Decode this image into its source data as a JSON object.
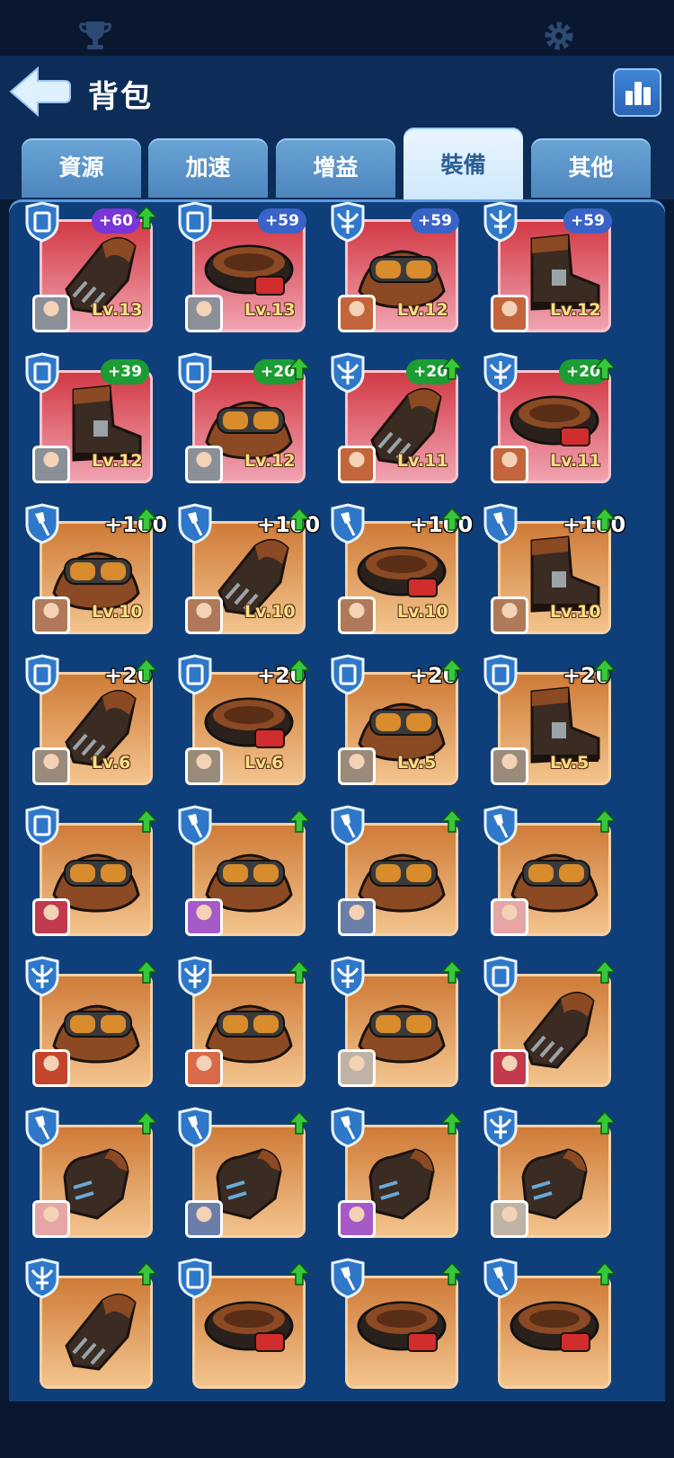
{
  "topbar": {
    "left_icon": "trophy-icon",
    "right_icon": "gear-icon"
  },
  "header": {
    "title": "背包",
    "back_icon": "back-arrow-icon",
    "stats_icon": "bar-chart-icon"
  },
  "tabs": [
    {
      "label": "資源",
      "active": false
    },
    {
      "label": "加速",
      "active": false
    },
    {
      "label": "增益",
      "active": false
    },
    {
      "label": "裝備",
      "active": true
    },
    {
      "label": "其他",
      "active": false
    }
  ],
  "items": [
    {
      "type": "shield",
      "gear": "gauntlet",
      "bg": "red",
      "plus": "+60",
      "plus_style": "purple",
      "up": true,
      "level": "Lv.13",
      "avatar": "#8a8f98"
    },
    {
      "type": "shield",
      "gear": "belt",
      "bg": "red",
      "plus": "+59",
      "plus_style": "blue",
      "up": false,
      "level": "Lv.13",
      "avatar": "#8a8f98"
    },
    {
      "type": "crossbow",
      "gear": "goggles",
      "bg": "red",
      "plus": "+59",
      "plus_style": "blue",
      "up": false,
      "level": "Lv.12",
      "avatar": "#c4643a"
    },
    {
      "type": "crossbow",
      "gear": "boot",
      "bg": "red",
      "plus": "+59",
      "plus_style": "blue",
      "up": false,
      "level": "Lv.12",
      "avatar": "#c4643a"
    },
    {
      "type": "shield",
      "gear": "boot",
      "bg": "red",
      "plus": "+39",
      "plus_style": "green",
      "up": false,
      "level": "Lv.12",
      "avatar": "#8a8f98"
    },
    {
      "type": "shield",
      "gear": "goggles",
      "bg": "red",
      "plus": "+20",
      "plus_style": "green",
      "up": true,
      "level": "Lv.12",
      "avatar": "#8a8f98"
    },
    {
      "type": "crossbow",
      "gear": "gauntlet",
      "bg": "red",
      "plus": "+20",
      "plus_style": "green",
      "up": true,
      "level": "Lv.11",
      "avatar": "#c4643a"
    },
    {
      "type": "crossbow",
      "gear": "belt",
      "bg": "red",
      "plus": "+20",
      "plus_style": "green",
      "up": true,
      "level": "Lv.11",
      "avatar": "#c4643a"
    },
    {
      "type": "shovel",
      "gear": "goggles",
      "bg": "gold",
      "plus": "+100",
      "plus_style": "plain",
      "up": true,
      "level": "Lv.10",
      "avatar": "#b07a5a"
    },
    {
      "type": "shovel",
      "gear": "gauntlet",
      "bg": "gold",
      "plus": "+100",
      "plus_style": "plain",
      "up": true,
      "level": "Lv.10",
      "avatar": "#b07a5a"
    },
    {
      "type": "shovel",
      "gear": "belt",
      "bg": "gold",
      "plus": "+100",
      "plus_style": "plain",
      "up": true,
      "level": "Lv.10",
      "avatar": "#b07a5a"
    },
    {
      "type": "shovel",
      "gear": "boot",
      "bg": "gold",
      "plus": "+100",
      "plus_style": "plain",
      "up": true,
      "level": "Lv.10",
      "avatar": "#b07a5a"
    },
    {
      "type": "shield",
      "gear": "gauntlet",
      "bg": "gold",
      "plus": "+20",
      "plus_style": "plain",
      "up": true,
      "level": "Lv.6",
      "avatar": "#9a8a7a"
    },
    {
      "type": "shield",
      "gear": "belt",
      "bg": "gold",
      "plus": "+20",
      "plus_style": "plain",
      "up": true,
      "level": "Lv.6",
      "avatar": "#9a8a7a"
    },
    {
      "type": "shield",
      "gear": "goggles",
      "bg": "gold",
      "plus": "+20",
      "plus_style": "plain",
      "up": true,
      "level": "Lv.5",
      "avatar": "#9a8a7a"
    },
    {
      "type": "shield",
      "gear": "boot",
      "bg": "gold",
      "plus": "+20",
      "plus_style": "plain",
      "up": true,
      "level": "Lv.5",
      "avatar": "#9a8a7a"
    },
    {
      "type": "shield",
      "gear": "goggles",
      "bg": "gold",
      "plus": "",
      "plus_style": "plain",
      "up": true,
      "level": "",
      "avatar": "#c23a4e"
    },
    {
      "type": "shovel",
      "gear": "goggles",
      "bg": "gold",
      "plus": "",
      "plus_style": "plain",
      "up": true,
      "level": "",
      "avatar": "#a65ac8"
    },
    {
      "type": "shovel",
      "gear": "goggles",
      "bg": "gold",
      "plus": "",
      "plus_style": "plain",
      "up": true,
      "level": "",
      "avatar": "#6a7ea8"
    },
    {
      "type": "shovel",
      "gear": "goggles",
      "bg": "gold",
      "plus": "",
      "plus_style": "plain",
      "up": true,
      "level": "",
      "avatar": "#e7a6a6"
    },
    {
      "type": "crossbow",
      "gear": "goggles",
      "bg": "gold",
      "plus": "",
      "plus_style": "plain",
      "up": true,
      "level": "",
      "avatar": "#c2452c"
    },
    {
      "type": "crossbow",
      "gear": "goggles",
      "bg": "gold",
      "plus": "",
      "plus_style": "plain",
      "up": true,
      "level": "",
      "avatar": "#d86a4a"
    },
    {
      "type": "crossbow",
      "gear": "goggles",
      "bg": "gold",
      "plus": "",
      "plus_style": "plain",
      "up": true,
      "level": "",
      "avatar": "#bfb3a6"
    },
    {
      "type": "shield",
      "gear": "gauntlet",
      "bg": "gold",
      "plus": "",
      "plus_style": "plain",
      "up": true,
      "level": "",
      "avatar": "#c23a4e"
    },
    {
      "type": "shovel",
      "gear": "glove",
      "bg": "gold",
      "plus": "",
      "plus_style": "plain",
      "up": true,
      "level": "",
      "avatar": "#e7a6a6"
    },
    {
      "type": "shovel",
      "gear": "glove",
      "bg": "gold",
      "plus": "",
      "plus_style": "plain",
      "up": true,
      "level": "",
      "avatar": "#6a7ea8"
    },
    {
      "type": "shovel",
      "gear": "glove",
      "bg": "gold",
      "plus": "",
      "plus_style": "plain",
      "up": true,
      "level": "",
      "avatar": "#a65ac8"
    },
    {
      "type": "crossbow",
      "gear": "glove",
      "bg": "gold",
      "plus": "",
      "plus_style": "plain",
      "up": true,
      "level": "",
      "avatar": "#bfb3a6"
    },
    {
      "type": "crossbow",
      "gear": "gauntlet",
      "bg": "gold",
      "plus": "",
      "plus_style": "plain",
      "up": true,
      "level": "",
      "avatar": ""
    },
    {
      "type": "shield",
      "gear": "belt",
      "bg": "gold",
      "plus": "",
      "plus_style": "plain",
      "up": true,
      "level": "",
      "avatar": ""
    },
    {
      "type": "shovel",
      "gear": "belt",
      "bg": "gold",
      "plus": "",
      "plus_style": "plain",
      "up": true,
      "level": "",
      "avatar": ""
    },
    {
      "type": "shovel",
      "gear": "belt",
      "bg": "gold",
      "plus": "",
      "plus_style": "plain",
      "up": true,
      "level": "",
      "avatar": ""
    }
  ]
}
